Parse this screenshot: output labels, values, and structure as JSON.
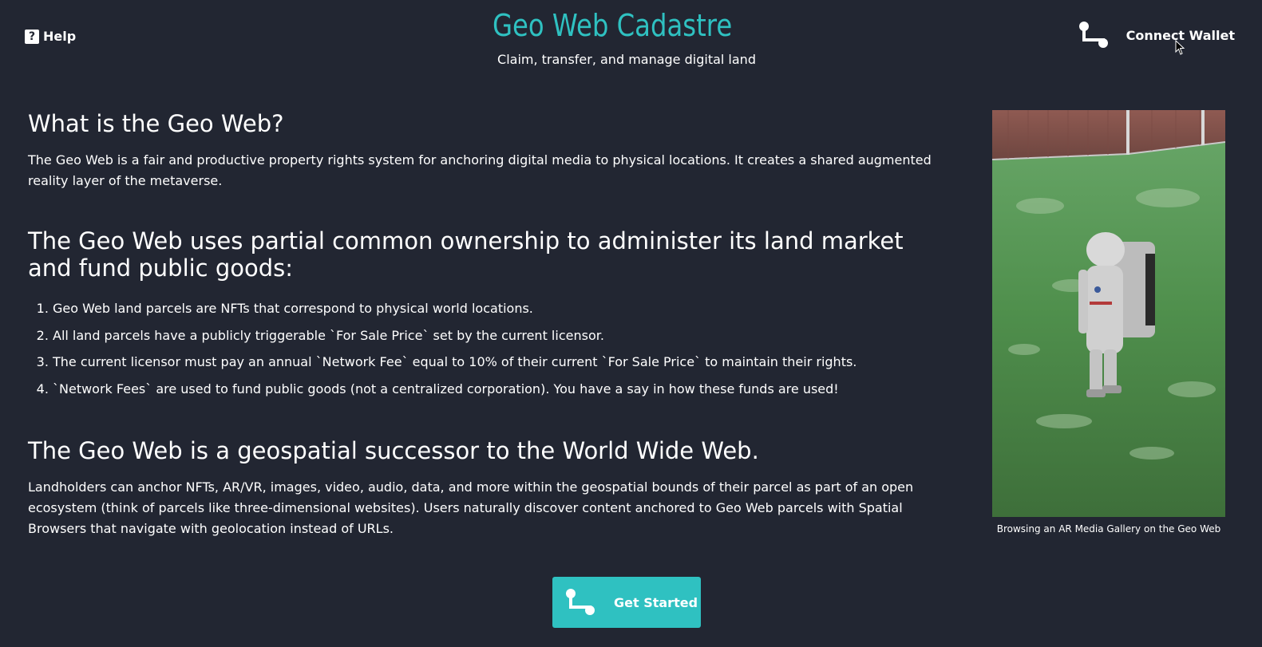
{
  "header": {
    "help_label": "Help",
    "help_icon": "help-icon",
    "app_title": "Geo Web Cadastre",
    "tagline": "Claim, transfer, and manage digital land",
    "logo_icon": "globe-sunglasses-logo",
    "connect_label": "Connect Wallet",
    "connect_icon": "wallet-connect-icon"
  },
  "colors": {
    "background": "#222632",
    "accent": "#2fc1c1",
    "text": "#ffffff"
  },
  "main": {
    "what_heading": "What is the Geo Web?",
    "what_text": "The Geo Web is a fair and productive property rights system for anchoring digital media to physical locations. It creates a shared augmented reality layer of the metaverse.",
    "pco_heading": "The Geo Web uses partial common ownership to administer its land market and fund public goods:",
    "pco_items": [
      "Geo Web land parcels are NFTs that correspond to physical world locations.",
      "All land parcels have a publicly triggerable `For Sale Price` set by the current licensor.",
      "The current licensor must pay an annual `Network Fee` equal to 10% of their current `For Sale Price` to maintain their rights.",
      "`Network Fees` are used to fund public goods (not a centralized corporation). You have a say in how these funds are used!"
    ],
    "successor_heading": "The Geo Web is a geospatial successor to the World Wide Web.",
    "successor_text": "Landholders can anchor NFTs, AR/VR, images, video, audio, data, and more within the geospatial bounds of their parcel as part of an open ecosystem (think of parcels like three-dimensional websites). Users naturally discover content anchored to Geo Web parcels with Spatial Browsers that navigate with geolocation instead of URLs."
  },
  "media": {
    "caption": "Browsing an AR Media Gallery on the Geo Web"
  },
  "cta": {
    "get_started_label": "Get Started",
    "icon": "wallet-connect-icon"
  }
}
